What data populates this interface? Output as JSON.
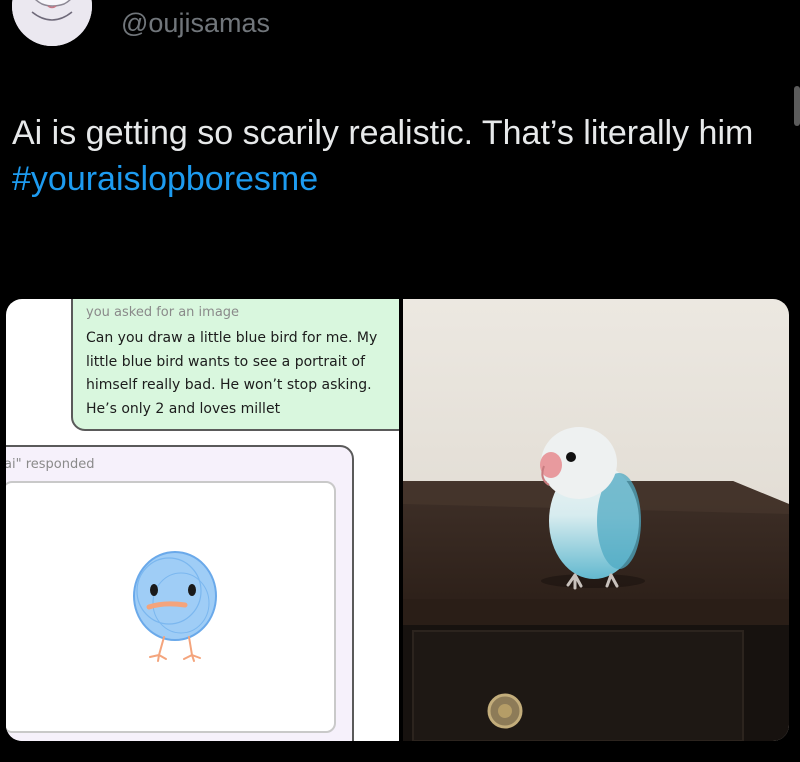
{
  "author": {
    "handle": "@oujisamas",
    "avatar_icon": "avatar-icon"
  },
  "tweet": {
    "text": "Ai is getting so scarily realistic. That’s literally him",
    "hashtag": "#youraislopboresme"
  },
  "media": {
    "screenshot": {
      "user_label": "you asked for an image",
      "prompt": "Can you draw a little blue bird for me. My little blue bird wants to see a portrait of himself really bad. He won’t stop asking. He’s only 2 and loves millet",
      "ai_label": "ai\" responded"
    }
  },
  "colors": {
    "background": "#000000",
    "text": "#e7e9ea",
    "handle": "#71767b",
    "link": "#1d9bf0"
  }
}
